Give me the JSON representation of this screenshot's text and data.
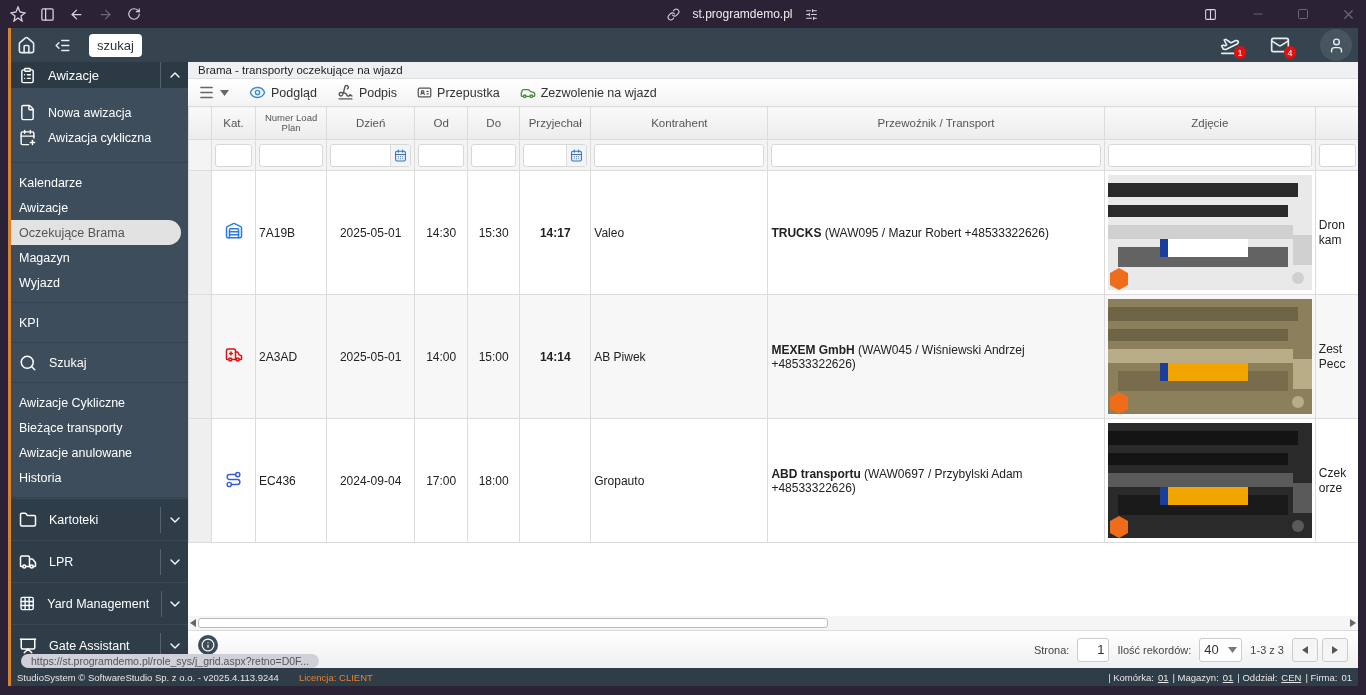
{
  "browser": {
    "url": "st.programdemo.pl"
  },
  "topbar": {
    "search_button": "szukaj",
    "notifications": [
      {
        "kind": "flight",
        "count": "1"
      },
      {
        "kind": "mail",
        "count": "4"
      }
    ]
  },
  "sidebar": {
    "section": {
      "label": "Awizacje",
      "expanded": true
    },
    "groups": [
      [
        {
          "label": "Nowa awizacja",
          "kind": "file",
          "selected": false
        },
        {
          "label": "Awizacja cykliczna",
          "kind": "calendar",
          "selected": false
        }
      ],
      [
        {
          "label": "Kalendarze",
          "selected": false
        },
        {
          "label": "Awizacje",
          "selected": false
        },
        {
          "label": "Oczekujące Brama",
          "selected": true
        },
        {
          "label": "Magazyn",
          "selected": false
        },
        {
          "label": "Wyjazd",
          "selected": false
        }
      ],
      [
        {
          "label": "KPI",
          "selected": false
        }
      ],
      [
        {
          "label": "Szukaj",
          "kind": "search",
          "selected": false
        }
      ],
      [
        {
          "label": "Awizacje Cykliczne",
          "selected": false
        },
        {
          "label": "Bieżące transporty",
          "selected": false
        },
        {
          "label": "Awizacje anulowane",
          "selected": false
        },
        {
          "label": "Historia",
          "selected": false
        }
      ]
    ],
    "sections": [
      {
        "label": "Kartoteki",
        "kind": "folder",
        "expanded": false
      },
      {
        "label": "LPR",
        "kind": "truck",
        "expanded": false
      },
      {
        "label": "Yard Management",
        "kind": "grid",
        "expanded": false
      },
      {
        "label": "Gate Assistant",
        "kind": "presenter",
        "expanded": false
      }
    ]
  },
  "panel": {
    "title": "Brama - transporty oczekujące na wjazd",
    "toolbar": [
      {
        "label": "Podgląd",
        "kind": "view"
      },
      {
        "label": "Podpis",
        "kind": "sign"
      },
      {
        "label": "Przepustka",
        "kind": "pass"
      },
      {
        "label": "Zezwolenie na wjazd",
        "kind": "entry"
      }
    ]
  },
  "table": {
    "columns": [
      {
        "label": "Kat.",
        "kind": "text"
      },
      {
        "label": "Numer Load Plan",
        "kind": "text"
      },
      {
        "label": "Dzień",
        "kind": "date"
      },
      {
        "label": "Od",
        "kind": "text"
      },
      {
        "label": "Do",
        "kind": "text"
      },
      {
        "label": "Przyjechał",
        "kind": "date"
      },
      {
        "label": "Kontrahent",
        "kind": "text"
      },
      {
        "label": "Przewoźnik / Transport",
        "kind": "text"
      },
      {
        "label": "Zdjęcie",
        "kind": "text"
      },
      {
        "kind": "text"
      }
    ],
    "rows": [
      {
        "kind": "warehouse",
        "load_plan": "7A19B",
        "day": "2025-05-01",
        "from": "14:30",
        "to": "15:30",
        "arrived": "14:17",
        "contractor": "Valeo",
        "carrier": "**TRUCKS** (WAW095 / Mazur Robert +48533322626)",
        "photo": {
          "kind": "picture"
        },
        "column_10": [
          "Dron",
          "kam"
        ]
      },
      {
        "kind": "ambulance",
        "load_plan": "2A3AD",
        "day": "2025-05-01",
        "from": "14:00",
        "to": "15:00",
        "arrived": "14:14",
        "contractor": "AB Piwek",
        "carrier": "**MEXEM GmbH** (WAW045 / Wiśniewski Andrzej +48533322626)",
        "photo": {
          "kind": "picture"
        },
        "column_10": [
          "Zest",
          "Pecc"
        ]
      },
      {
        "kind": "route",
        "load_plan": "EC436",
        "day": "2024-09-04",
        "from": "17:00",
        "to": "18:00",
        "contractor": "Gropauto",
        "carrier": "**ABD transportu** (WAW0697 / Przybylski Adam +48533322626)",
        "photo": {
          "kind": "picture"
        },
        "column_10": [
          "Czek",
          "orze"
        ]
      }
    ]
  },
  "pager": {
    "page_label": "Strona:",
    "page": "1",
    "records_label": "Ilość rekordów:",
    "records": "40",
    "range": "1-3 z 3"
  },
  "status_tooltip": "https://st.programdemo.pl/role_sys/j_grid.aspx?retno=D0F...",
  "footer": {
    "copyright": "StudioSystem © SoftwareStudio Sp. z o.o. - v2025.4.113.9244",
    "license": "Licencja: CLIENT",
    "context": [
      {
        "label": "| Komórka:",
        "value": "01",
        "underlined": true
      },
      {
        "label": "| Magazyn:",
        "value": "01",
        "underlined": true
      },
      {
        "label": "| Oddział:",
        "value": "CEN",
        "underlined": true
      },
      {
        "label": "| Firma:",
        "value": "01",
        "underlined": false
      }
    ]
  }
}
